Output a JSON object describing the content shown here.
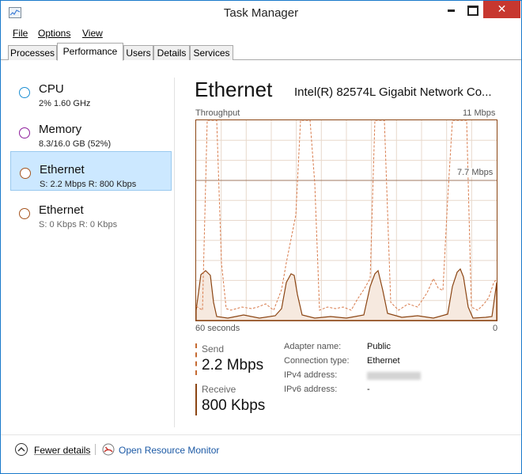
{
  "window": {
    "title": "Task Manager"
  },
  "menu": [
    {
      "label": "File"
    },
    {
      "label": "Options"
    },
    {
      "label": "View"
    }
  ],
  "tabs": [
    {
      "label": "Processes",
      "active": false
    },
    {
      "label": "Performance",
      "active": true
    },
    {
      "label": "Users",
      "active": false
    },
    {
      "label": "Details",
      "active": false
    },
    {
      "label": "Services",
      "active": false
    }
  ],
  "sidebar": {
    "items": [
      {
        "title": "CPU",
        "sub": "2% 1.60 GHz",
        "color": "#1d8fd3",
        "selected": false
      },
      {
        "title": "Memory",
        "sub": "8.3/16.0 GB (52%)",
        "color": "#8e1e9c",
        "selected": false
      },
      {
        "title": "Ethernet",
        "sub_s": "S: 2.2 Mbps",
        "sub_r": "R: 800 Kbps",
        "color": "#a5541e",
        "selected": true
      },
      {
        "title": "Ethernet",
        "sub_s": "S: 0 Kbps",
        "sub_r": "R: 0 Kbps",
        "color": "#a5541e",
        "selected": false
      }
    ]
  },
  "detail": {
    "heading": "Ethernet",
    "adapter": "Intel(R) 82574L Gigabit Network Co...",
    "graph": {
      "label_top_left": "Throughput",
      "label_top_right": "11 Mbps",
      "label_mid": "7.7 Mbps",
      "label_bottom_left": "60 seconds",
      "label_bottom_right": "0"
    },
    "send": {
      "label": "Send",
      "value": "2.2 Mbps"
    },
    "receive": {
      "label": "Receive",
      "value": "800 Kbps"
    },
    "props": [
      {
        "key": "Adapter name:",
        "value": "Public"
      },
      {
        "key": "Connection type:",
        "value": "Ethernet"
      },
      {
        "key": "IPv4 address:",
        "value": ""
      },
      {
        "key": "IPv6 address:",
        "value": "-"
      }
    ]
  },
  "footer": {
    "fewer_details": "Fewer details",
    "resource_monitor": "Open Resource Monitor"
  },
  "colors": {
    "graph_line": "#8b4513",
    "graph_dashed": "#d87a4a",
    "selection_bg": "#cce8ff",
    "link": "#1b59a5",
    "close_button": "#c7372f"
  }
}
